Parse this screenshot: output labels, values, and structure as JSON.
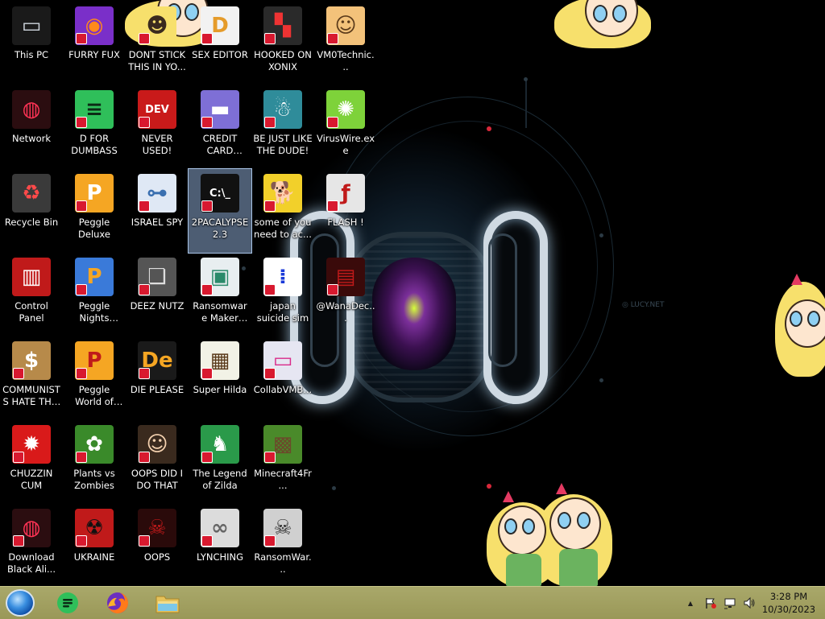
{
  "desktop": {
    "icons": [
      {
        "label": "This PC",
        "icon": "computer-icon"
      },
      {
        "label": "FURRY FUX",
        "icon": "firefox-icon"
      },
      {
        "label": "DONT STICK THIS IN YO...",
        "icon": "cartoon-icon"
      },
      {
        "label": "SEX EDITOR",
        "icon": "editor-icon"
      },
      {
        "label": "HOOKED ON XONIX",
        "icon": "xonix-icon"
      },
      {
        "label": "VM0Technic...",
        "icon": "doctor-icon"
      },
      {
        "label": "Network",
        "icon": "network-icon"
      },
      {
        "label": "D FOR DUMBASS",
        "icon": "chat-icon"
      },
      {
        "label": "NEVER USED!",
        "icon": "devcpp-icon"
      },
      {
        "label": "CREDIT CARD CHECKER",
        "icon": "credit-card-icon"
      },
      {
        "label": "BE JUST LIKE THE DUDE!",
        "icon": "santa-icon"
      },
      {
        "label": "VirusWire.exe",
        "icon": "lime-icon"
      },
      {
        "label": "Recycle Bin",
        "icon": "recycle-bin-icon"
      },
      {
        "label": "Peggle Deluxe",
        "icon": "peggle-icon"
      },
      {
        "label": "ISRAEL SPY",
        "icon": "spy-icon"
      },
      {
        "label": "2PACALYPSE 2.3",
        "icon": "terminal-icon"
      },
      {
        "label": "some of you need to ac...",
        "icon": "dog-icon"
      },
      {
        "label": "FLASH !",
        "icon": "flash-icon"
      },
      {
        "label": "Control Panel",
        "icon": "control-panel-icon"
      },
      {
        "label": "Peggle Nights Deluxe",
        "icon": "peggle-nights-icon"
      },
      {
        "label": "DEEZ NUTZ",
        "icon": "windows-stack-icon"
      },
      {
        "label": "Ransomware Maker Build...",
        "icon": "ransomware-builder-icon"
      },
      {
        "label": "japan suicide sim",
        "icon": "document-icon"
      },
      {
        "label": "@WanaDec...",
        "icon": "wannadecryptor-icon"
      },
      {
        "label": "COMMUNISTS HATE THIS G...",
        "icon": "money-bag-icon"
      },
      {
        "label": "Peggle World of Warcraft ...",
        "icon": "peggle-wow-icon"
      },
      {
        "label": "DIE PLEASE",
        "icon": "de-icon"
      },
      {
        "label": "Super Hilda",
        "icon": "pixel-icon"
      },
      {
        "label": "CollabVMB...",
        "icon": "collabvm-icon"
      },
      {
        "label": "CHUZZIN CUM",
        "icon": "chuzzle-icon"
      },
      {
        "label": "Plants vs Zombies",
        "icon": "plant-icon"
      },
      {
        "label": "OOPS DID I DO THAT",
        "icon": "portrait-icon"
      },
      {
        "label": "The Legend of Zilda",
        "icon": "zilda-icon"
      },
      {
        "label": "Minecraft4Fr...",
        "icon": "minecraft-icon"
      },
      {
        "label": "Download Black Ali...",
        "icon": "alien-icon"
      },
      {
        "label": "UKRAINE",
        "icon": "radiation-icon"
      },
      {
        "label": "OOPS",
        "icon": "oops-icon"
      },
      {
        "label": "LYNCHING",
        "icon": "rope-icon"
      },
      {
        "label": "RansomWar...",
        "icon": "skull-ring-icon"
      }
    ],
    "selected_label": "2PACALYPSE 2.3"
  },
  "taskbar": {
    "start": "windows-start-orb-icon",
    "pinned": [
      {
        "name": "chat-app",
        "icon": "green-chat-icon"
      },
      {
        "name": "firefox",
        "icon": "firefox-icon"
      },
      {
        "name": "file-explorer",
        "icon": "folder-icon"
      }
    ],
    "tray": {
      "show_hidden": "▲",
      "clock_time": "3:28 PM",
      "clock_date": "10/30/2023"
    }
  },
  "colors": {
    "taskbar": "#a3a262",
    "selection": "#8caad2",
    "shortcut_badge": "#d8192f"
  }
}
